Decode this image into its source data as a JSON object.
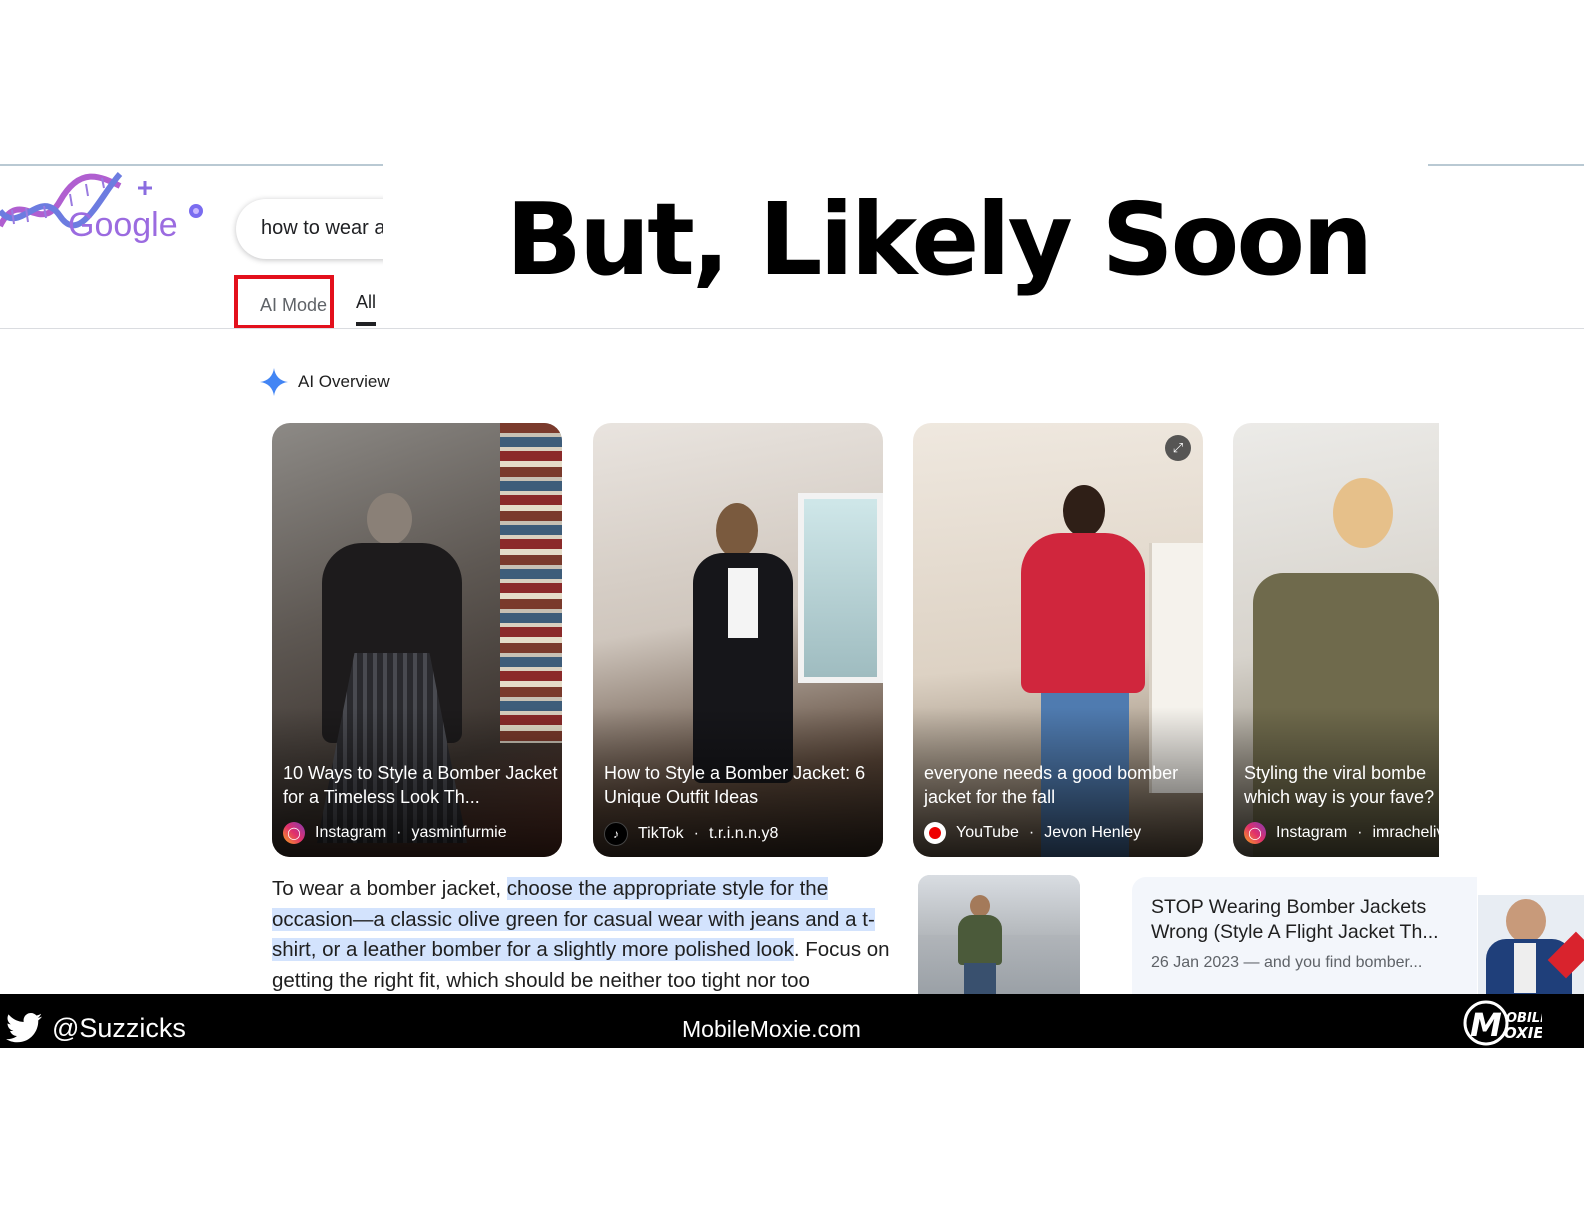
{
  "slide": {
    "title": "But, Likely Soon"
  },
  "search": {
    "logo_label": "Google",
    "query_visible": "how to wear a",
    "tabs": [
      {
        "label": "AI Mode",
        "highlighted": true
      },
      {
        "label": "All",
        "selected": true
      }
    ]
  },
  "ai_overview": {
    "label": "AI Overview",
    "videos": [
      {
        "title": "10 Ways to Style a Bomber Jacket for a Timeless Look Th...",
        "source": "Instagram",
        "author": "yasminfurmie",
        "icon": "instagram-icon"
      },
      {
        "title": "How to Style a Bomber Jacket: 6 Unique Outfit Ideas",
        "source": "TikTok",
        "author": "t.r.i.n.n.y8",
        "icon": "tiktok-icon"
      },
      {
        "title": "everyone needs a good bomber jacket for the fall",
        "source": "YouTube",
        "author": "Jevon Henley",
        "icon": "youtube-icon"
      },
      {
        "title": "Styling the viral bombe which way is your fave?",
        "source": "Instagram",
        "author": "imracheliv",
        "icon": "instagram-icon"
      }
    ],
    "overview_text": {
      "intro": "To wear a bomber jacket, ",
      "highlighted": "choose the appropriate style for the occasion—a classic olive green for casual wear with jeans and a t-shirt, or a leather bomber for a slightly more polished look",
      "rest": ". Focus on getting the right fit, which should be neither too tight nor too"
    },
    "source_card": {
      "title": "STOP Wearing Bomber Jackets Wrong (Style A Flight Jacket Th...",
      "meta": "26 Jan 2023 — and you find bomber..."
    }
  },
  "footer": {
    "handle": "@Suzzicks",
    "site": "MobileMoxie.com",
    "logo_text_top": "OBILE",
    "logo_text_bottom": "OXIE"
  },
  "colors": {
    "highlight_box": "#e3101c",
    "text_highlight": "#d3e3fd",
    "footer_bg": "#000000",
    "gemini_spark": "#4285f4"
  }
}
